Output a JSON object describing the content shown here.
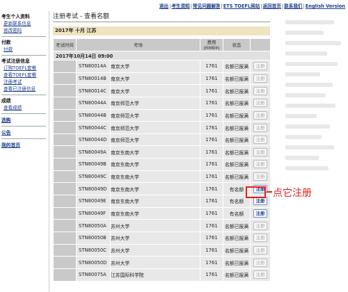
{
  "topnav": [
    {
      "label": "退出"
    },
    {
      "label": "考生须知"
    },
    {
      "label": "常见问题解答"
    },
    {
      "label": "ETS TOEFL网站"
    },
    {
      "label": "返回首页"
    },
    {
      "label": "联系我们"
    },
    {
      "label": "English Version"
    }
  ],
  "sidebar": {
    "profile_title": "考生个人资料",
    "profile_links": [
      "更新联系信息",
      "修改密码"
    ],
    "payment_title": "付款",
    "payment_links": [
      "付款"
    ],
    "exam_title": "考试注册信息",
    "exam_links": [
      "订购TOEFL套餐",
      "查看TOEFL套餐",
      "注册考试",
      "查看已注册信息"
    ],
    "score_title": "成绩",
    "score_links": [
      "查看成绩"
    ],
    "extra_links": [
      "选购",
      "公告",
      "我的首页"
    ]
  },
  "page": {
    "title": "注册考试 - 查看名额",
    "banner": "2017年 十月 江苏"
  },
  "table": {
    "headers": [
      "考试时间",
      "考场",
      "费用(RMB¥)",
      "状态"
    ],
    "date_row": "2017年10月14日  09:00",
    "rows": [
      {
        "code": "STN80014A",
        "site": "南京大学",
        "fee": "1761",
        "status": "名额已报满",
        "btn": "注册",
        "active": false
      },
      {
        "code": "STN80014B",
        "site": "南京大学",
        "fee": "1761",
        "status": "名额已报满",
        "btn": "注册",
        "active": false
      },
      {
        "code": "STN80014C",
        "site": "南京大学",
        "fee": "1761",
        "status": "名额已报满",
        "btn": "注册",
        "active": false
      },
      {
        "code": "STN80044A",
        "site": "南京师范大学",
        "fee": "1761",
        "status": "名额已报满",
        "btn": "注册",
        "active": false
      },
      {
        "code": "STN80044B",
        "site": "南京师范大学",
        "fee": "1761",
        "status": "名额已报满",
        "btn": "注册",
        "active": false
      },
      {
        "code": "STN80044C",
        "site": "南京师范大学",
        "fee": "1761",
        "status": "名额已报满",
        "btn": "注册",
        "active": false
      },
      {
        "code": "STN80044D",
        "site": "南京师范大学",
        "fee": "1761",
        "status": "名额已报满",
        "btn": "注册",
        "active": false
      },
      {
        "code": "STN80049A",
        "site": "南京东南大学",
        "fee": "1761",
        "status": "名额已报满",
        "btn": "注册",
        "active": false
      },
      {
        "code": "STN80049B",
        "site": "南京东南大学",
        "fee": "1761",
        "status": "名额已报满",
        "btn": "注册",
        "active": false
      },
      {
        "code": "STN80049C",
        "site": "南京东南大学",
        "fee": "1761",
        "status": "名额已报满",
        "btn": "注册",
        "active": false
      },
      {
        "code": "STN80049D",
        "site": "南京东南大学",
        "fee": "1761",
        "status": "有名额",
        "btn": "注册",
        "active": true
      },
      {
        "code": "STN80049E",
        "site": "南京东南大学",
        "fee": "1761",
        "status": "有名额",
        "btn": "注册",
        "active": true
      },
      {
        "code": "STN80049F",
        "site": "南京东南大学",
        "fee": "1761",
        "status": "有名额",
        "btn": "注册",
        "active": true
      },
      {
        "code": "STN80050A",
        "site": "苏州大学",
        "fee": "1761",
        "status": "名额已报满",
        "btn": "注册",
        "active": false
      },
      {
        "code": "STN80050B",
        "site": "苏州大学",
        "fee": "1761",
        "status": "名额已报满",
        "btn": "注册",
        "active": false
      },
      {
        "code": "STN80050C",
        "site": "苏州大学",
        "fee": "1761",
        "status": "名额已报满",
        "btn": "注册",
        "active": false
      },
      {
        "code": "STN80050D",
        "site": "苏州大学",
        "fee": "1761",
        "status": "名额已报满",
        "btn": "注册",
        "active": false
      },
      {
        "code": "STN80075A",
        "site": "江苏国际科学院",
        "fee": "1761",
        "status": "名额已报满",
        "btn": "注册",
        "active": false
      }
    ]
  },
  "annotation": {
    "text": "点它注册",
    "color": "#e0201e"
  },
  "colors": {
    "link": "#1a3c8c",
    "banner_bg": "#efe3c0",
    "header_bg": "#c9c9c9",
    "row_bg": "#e8e8e8"
  }
}
